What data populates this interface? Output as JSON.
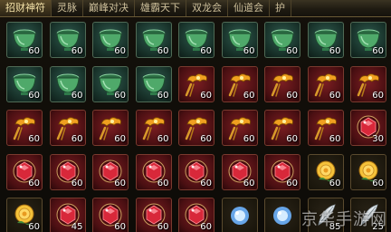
{
  "tabs": [
    {
      "label": "招财神符",
      "active": true
    },
    {
      "label": "灵脉",
      "active": false
    },
    {
      "label": "巅峰对决",
      "active": false
    },
    {
      "label": "雄霸天下",
      "active": false
    },
    {
      "label": "双龙会",
      "active": false
    },
    {
      "label": "仙道会",
      "active": false
    },
    {
      "label": "护",
      "active": false
    }
  ],
  "colors": {
    "jade": "#4fa96a",
    "gold": "#f0a020",
    "ruby": "#d8283a",
    "rose": "#f5c23a",
    "orb": "#6fb4ff"
  },
  "inventory": {
    "rows": [
      [
        {
          "icon": "jade-bowl-icon",
          "count": "60"
        },
        {
          "icon": "jade-bowl-icon",
          "count": "60"
        },
        {
          "icon": "jade-bowl-icon",
          "count": "60"
        },
        {
          "icon": "jade-bowl-icon",
          "count": "60"
        },
        {
          "icon": "jade-bowl-icon",
          "count": "60"
        },
        {
          "icon": "jade-bowl-icon",
          "count": "60"
        },
        {
          "icon": "jade-bowl-icon",
          "count": "60"
        },
        {
          "icon": "jade-bowl-icon",
          "count": "60"
        },
        {
          "icon": "jade-bowl-icon",
          "count": "60"
        }
      ],
      [
        {
          "icon": "jade-bowl-icon",
          "count": "60"
        },
        {
          "icon": "jade-bowl-icon",
          "count": "60"
        },
        {
          "icon": "jade-bowl-icon",
          "count": "60"
        },
        {
          "icon": "jade-bowl-icon",
          "count": "60"
        },
        {
          "icon": "golden-cloud-icon",
          "count": "60"
        },
        {
          "icon": "golden-cloud-icon",
          "count": "60"
        },
        {
          "icon": "golden-cloud-icon",
          "count": "60"
        },
        {
          "icon": "golden-cloud-icon",
          "count": "60"
        },
        {
          "icon": "golden-cloud-icon",
          "count": "60"
        }
      ],
      [
        {
          "icon": "golden-cloud-icon",
          "count": "60"
        },
        {
          "icon": "golden-cloud-icon",
          "count": "60"
        },
        {
          "icon": "golden-cloud-icon",
          "count": "60"
        },
        {
          "icon": "golden-cloud-icon",
          "count": "60"
        },
        {
          "icon": "golden-cloud-icon",
          "count": "60"
        },
        {
          "icon": "golden-cloud-icon",
          "count": "60"
        },
        {
          "icon": "golden-cloud-icon",
          "count": "60"
        },
        {
          "icon": "golden-cloud-icon",
          "count": "60"
        },
        {
          "icon": "red-gem-icon",
          "count": "30"
        }
      ],
      [
        {
          "icon": "red-gem-icon",
          "count": "60"
        },
        {
          "icon": "red-gem-icon",
          "count": "60"
        },
        {
          "icon": "red-gem-icon",
          "count": "60"
        },
        {
          "icon": "red-gem-icon",
          "count": "60"
        },
        {
          "icon": "red-gem-icon",
          "count": "60"
        },
        {
          "icon": "red-gem-icon",
          "count": "60"
        },
        {
          "icon": "red-gem-icon",
          "count": "60"
        },
        {
          "icon": "golden-rose-icon",
          "count": "60"
        },
        {
          "icon": "golden-rose-icon",
          "count": "60"
        }
      ],
      [
        {
          "icon": "golden-rose-icon",
          "count": "60"
        },
        {
          "icon": "red-gem-icon",
          "count": "45"
        },
        {
          "icon": "red-gem-icon",
          "count": "60"
        },
        {
          "icon": "red-gem-icon",
          "count": "60"
        },
        {
          "icon": "red-gem-icon",
          "count": "60"
        },
        {
          "icon": "blue-orb-icon",
          "count": ""
        },
        {
          "icon": "blue-orb-icon",
          "count": ""
        },
        {
          "icon": "white-feather-icon",
          "count": "85"
        },
        {
          "icon": "white-feather-icon",
          "count": "25"
        }
      ]
    ]
  },
  "watermark": "京华手游网"
}
